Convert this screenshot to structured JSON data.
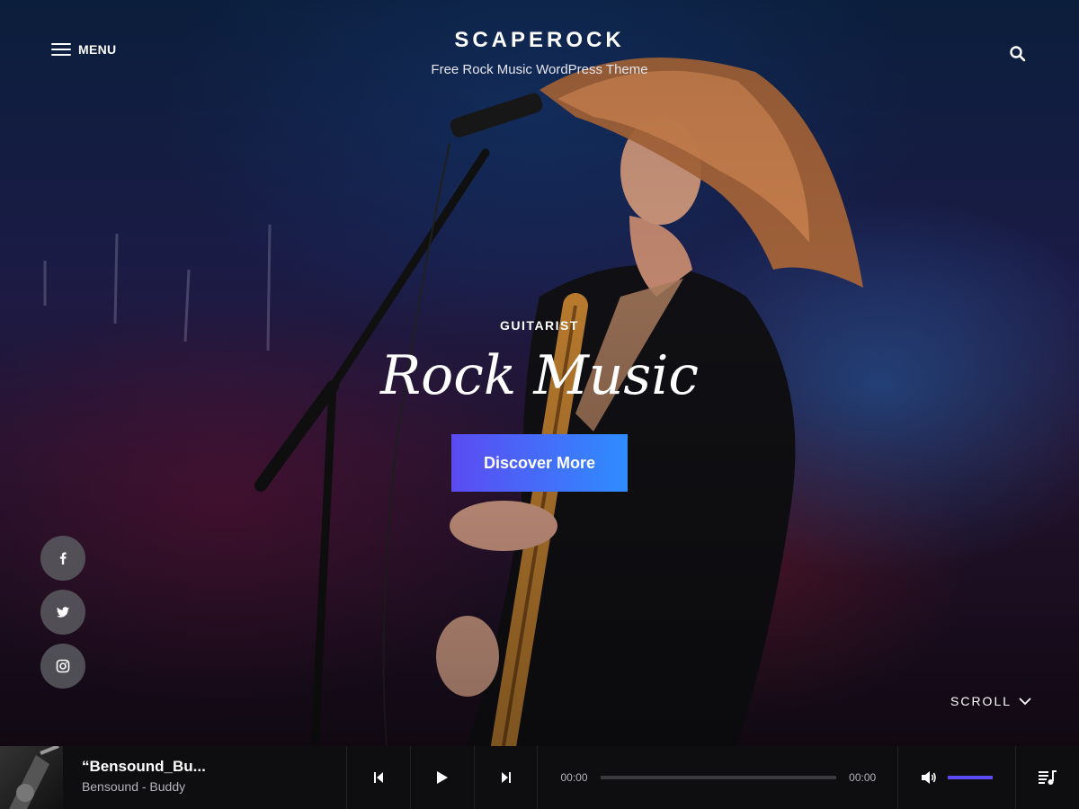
{
  "header": {
    "menu_label": "MENU",
    "site_title": "SCAPEROCK",
    "tagline": "Free Rock Music WordPress Theme",
    "menu_icon": "hamburger-icon",
    "search_icon": "search-icon"
  },
  "hero": {
    "eyebrow": "GUITARIST",
    "title": "Rock Music",
    "cta_label": "Discover More",
    "cta_gradient": [
      "#5b4bf2",
      "#2f8cff"
    ]
  },
  "social": [
    {
      "network": "facebook",
      "icon": "facebook-icon"
    },
    {
      "network": "twitter",
      "icon": "twitter-icon"
    },
    {
      "network": "instagram",
      "icon": "instagram-icon"
    }
  ],
  "scroll": {
    "label": "SCROLL",
    "icon": "chevron-down-icon"
  },
  "player": {
    "track_title": "“Bensound_Bu...",
    "track_artist": "Bensound - Buddy",
    "current_time": "00:00",
    "duration": "00:00",
    "progress": 0,
    "volume": 1,
    "accent": "#5b4bf2",
    "icons": {
      "prev": "skip-back-icon",
      "play": "play-icon",
      "next": "skip-forward-icon",
      "volume": "volume-icon",
      "playlist": "playlist-icon"
    }
  }
}
